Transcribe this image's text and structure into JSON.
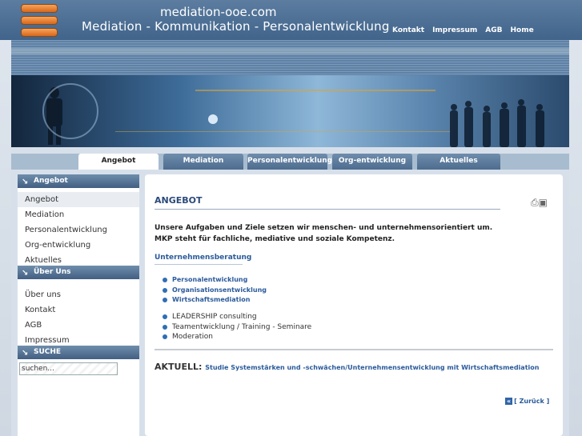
{
  "header": {
    "site": "mediation-ooe.com",
    "slogan": "Mediation - Kommunikation - Personalentwicklung",
    "nav": [
      "Kontakt",
      "Impressum",
      "AGB",
      "Home"
    ]
  },
  "tabs": [
    "Angebot",
    "Mediation",
    "Personalentwicklung",
    "Org-entwicklung",
    "Aktuelles"
  ],
  "sidebar": {
    "sections": [
      {
        "title": "Angebot",
        "items": [
          "Angebot",
          "Mediation",
          "Personalentwicklung",
          "Org-entwicklung",
          "Aktuelles"
        ]
      },
      {
        "title": "Über Uns",
        "items": [
          "Über uns",
          "Kontakt",
          "AGB",
          "Impressum"
        ]
      }
    ],
    "search_title": "SUCHE",
    "search_value": "suchen..."
  },
  "content": {
    "title": "ANGEBOT",
    "intro": [
      "Unsere Aufgaben und Ziele setzen wir menschen- und unternehmensorientiert um.",
      "MKP steht für fachliche, mediative und soziale Kompetenz."
    ],
    "subheading": "Unternehmensberatung",
    "list1": [
      "Personalentwicklung",
      "Organisationsentwicklung",
      "Wirtschaftsmediation"
    ],
    "list2": [
      "LEADERSHIP consulting",
      "Teamentwicklung / Training  - Seminare",
      "Moderation"
    ],
    "aktuell_label": "AKTUELL:",
    "aktuell_link": "Studie Systemstärken und -schwächen/Unternehmensentwicklung mit Wirtschaftsmediation",
    "back": "[ Zurück ]"
  }
}
